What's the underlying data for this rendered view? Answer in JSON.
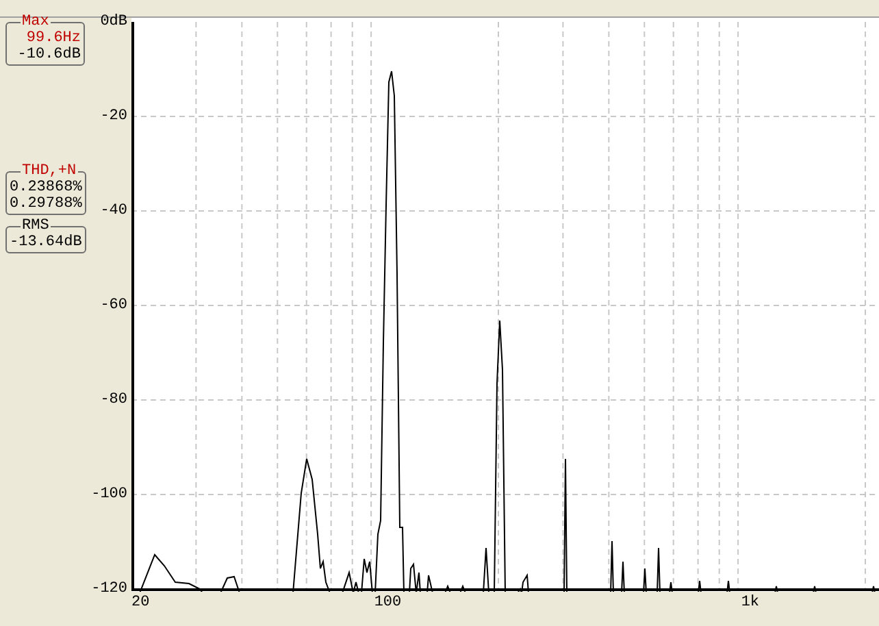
{
  "readouts": [
    {
      "kind": "peak",
      "title": "Max",
      "values": [
        "99.6Hz",
        "-10.6dB"
      ]
    },
    {
      "kind": "thd",
      "title": "THD,+N",
      "values": [
        "0.23868%",
        "0.29788%"
      ]
    },
    {
      "kind": "rms",
      "title": "RMS",
      "values": [
        "-13.64dB"
      ]
    }
  ],
  "plot": {
    "y_axis_labels": [
      "0dB",
      "-20",
      "-40",
      "-60",
      "-80",
      "-100",
      "-120"
    ],
    "x_axis_labels": [
      "20",
      "100",
      "1k"
    ]
  }
}
